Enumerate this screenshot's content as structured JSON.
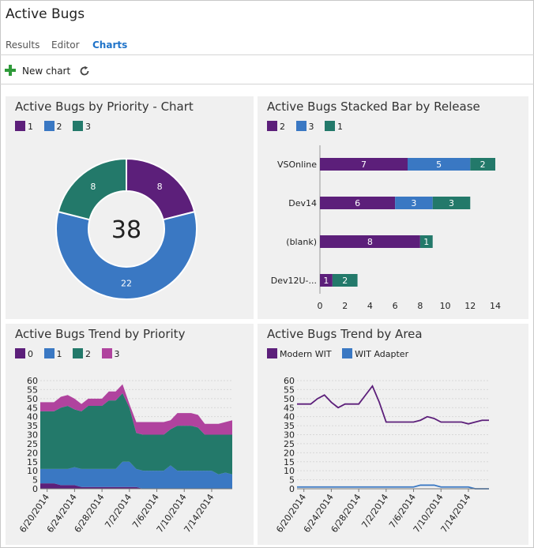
{
  "page": {
    "title": "Active Bugs"
  },
  "tabs": [
    {
      "label": "Results",
      "active": false
    },
    {
      "label": "Editor",
      "active": false
    },
    {
      "label": "Charts",
      "active": true
    }
  ],
  "toolbar": {
    "new_chart_label": "New chart",
    "refresh_icon": "refresh-icon",
    "add_icon": "plus-icon"
  },
  "colors": {
    "purple": "#5c1f7a",
    "blue": "#3a78c3",
    "teal": "#23796a",
    "magenta": "#b0439e",
    "accent": "#1f73c9",
    "add_green": "#2f9a3a"
  },
  "chart_data": [
    {
      "type": "pie",
      "title": "Active Bugs by Priority - Chart",
      "center_label": "38",
      "legend": [
        "1",
        "2",
        "3"
      ],
      "slices": [
        {
          "label": "1",
          "value": 8,
          "color": "#5c1f7a"
        },
        {
          "label": "2",
          "value": 22,
          "color": "#3a78c3"
        },
        {
          "label": "3",
          "value": 8,
          "color": "#23796a"
        }
      ]
    },
    {
      "type": "bar",
      "orientation": "horizontal",
      "stacked": true,
      "title": "Active Bugs Stacked Bar by Release",
      "legend": [
        "2",
        "3",
        "1"
      ],
      "categories": [
        "VSOnline",
        "Dev14",
        "(blank)",
        "Dev12U-..."
      ],
      "series": [
        {
          "name": "2",
          "color": "#5c1f7a",
          "values": [
            7,
            6,
            8,
            1
          ]
        },
        {
          "name": "3",
          "color": "#3a78c3",
          "values": [
            5,
            3,
            0,
            0
          ]
        },
        {
          "name": "1",
          "color": "#23796a",
          "values": [
            2,
            3,
            1,
            2
          ]
        }
      ],
      "xlim": [
        0,
        14
      ],
      "xticks": [
        "0",
        "2",
        "4",
        "6",
        "8",
        "10",
        "12",
        "14"
      ]
    },
    {
      "type": "area",
      "stacked": true,
      "title": "Active Bugs Trend by Priority",
      "legend": [
        "0",
        "1",
        "2",
        "3"
      ],
      "x": [
        "6/19/2014",
        "6/20/2014",
        "6/21/2014",
        "6/22/2014",
        "6/23/2014",
        "6/24/2014",
        "6/25/2014",
        "6/26/2014",
        "6/27/2014",
        "6/28/2014",
        "6/29/2014",
        "6/30/2014",
        "7/1/2014",
        "7/2/2014",
        "7/3/2014",
        "7/4/2014",
        "7/5/2014",
        "7/6/2014",
        "7/7/2014",
        "7/8/2014",
        "7/9/2014",
        "7/10/2014",
        "7/11/2014",
        "7/12/2014",
        "7/13/2014",
        "7/14/2014",
        "7/15/2014",
        "7/16/2014",
        "7/17/2014"
      ],
      "xticks": [
        "6/20/2014",
        "6/24/2014",
        "6/28/2014",
        "7/2/2014",
        "7/6/2014",
        "7/10/2014",
        "7/14/2014"
      ],
      "series": [
        {
          "name": "0",
          "color": "#5c1f7a",
          "values": [
            3,
            3,
            3,
            2,
            2,
            2,
            1,
            1,
            1,
            1,
            1,
            1,
            1,
            1,
            1,
            0,
            0,
            0,
            0,
            0,
            0,
            0,
            0,
            0,
            0,
            0,
            0,
            0,
            0
          ]
        },
        {
          "name": "1",
          "color": "#3a78c3",
          "values": [
            8,
            8,
            8,
            9,
            9,
            10,
            10,
            10,
            10,
            10,
            10,
            10,
            14,
            14,
            10,
            10,
            10,
            10,
            10,
            13,
            10,
            10,
            10,
            10,
            10,
            10,
            8,
            9,
            8
          ]
        },
        {
          "name": "2",
          "color": "#23796a",
          "values": [
            32,
            32,
            32,
            34,
            35,
            32,
            32,
            35,
            35,
            35,
            38,
            38,
            38,
            30,
            20,
            20,
            20,
            20,
            20,
            20,
            25,
            25,
            25,
            24,
            20,
            20,
            22,
            21,
            22
          ]
        },
        {
          "name": "3",
          "color": "#b0439e",
          "values": [
            5,
            5,
            5,
            6,
            6,
            6,
            4,
            4,
            4,
            4,
            5,
            5,
            5,
            2,
            6,
            7,
            7,
            7,
            7,
            5,
            7,
            7,
            7,
            7,
            6,
            6,
            6,
            7,
            8
          ]
        }
      ],
      "ylim": [
        0,
        60
      ],
      "yticks": [
        "0",
        "5",
        "10",
        "15",
        "20",
        "25",
        "30",
        "35",
        "40",
        "45",
        "50",
        "55",
        "60"
      ]
    },
    {
      "type": "line",
      "title": "Active Bugs Trend by Area",
      "legend": [
        "Modern WIT",
        "WIT Adapter"
      ],
      "x": [
        "6/19/2014",
        "6/20/2014",
        "6/21/2014",
        "6/22/2014",
        "6/23/2014",
        "6/24/2014",
        "6/25/2014",
        "6/26/2014",
        "6/27/2014",
        "6/28/2014",
        "6/29/2014",
        "6/30/2014",
        "7/1/2014",
        "7/2/2014",
        "7/3/2014",
        "7/4/2014",
        "7/5/2014",
        "7/6/2014",
        "7/7/2014",
        "7/8/2014",
        "7/9/2014",
        "7/10/2014",
        "7/11/2014",
        "7/12/2014",
        "7/13/2014",
        "7/14/2014",
        "7/15/2014",
        "7/16/2014",
        "7/17/2014"
      ],
      "xticks": [
        "6/20/2014",
        "6/24/2014",
        "6/28/2014",
        "7/2/2014",
        "7/6/2014",
        "7/10/2014",
        "7/14/2014"
      ],
      "series": [
        {
          "name": "Modern WIT",
          "color": "#5c1f7a",
          "values": [
            47,
            47,
            47,
            50,
            52,
            48,
            45,
            47,
            47,
            47,
            52,
            57,
            48,
            37,
            37,
            37,
            37,
            37,
            38,
            40,
            39,
            37,
            37,
            37,
            37,
            36,
            37,
            38,
            38
          ]
        },
        {
          "name": "WIT Adapter",
          "color": "#3a78c3",
          "values": [
            1,
            1,
            1,
            1,
            1,
            1,
            1,
            1,
            1,
            1,
            1,
            1,
            1,
            1,
            1,
            1,
            1,
            1,
            2,
            2,
            2,
            1,
            1,
            1,
            1,
            1,
            0,
            0,
            0
          ]
        }
      ],
      "ylim": [
        0,
        60
      ],
      "yticks": [
        "0",
        "5",
        "10",
        "15",
        "20",
        "25",
        "30",
        "35",
        "40",
        "45",
        "50",
        "55",
        "60"
      ]
    }
  ]
}
